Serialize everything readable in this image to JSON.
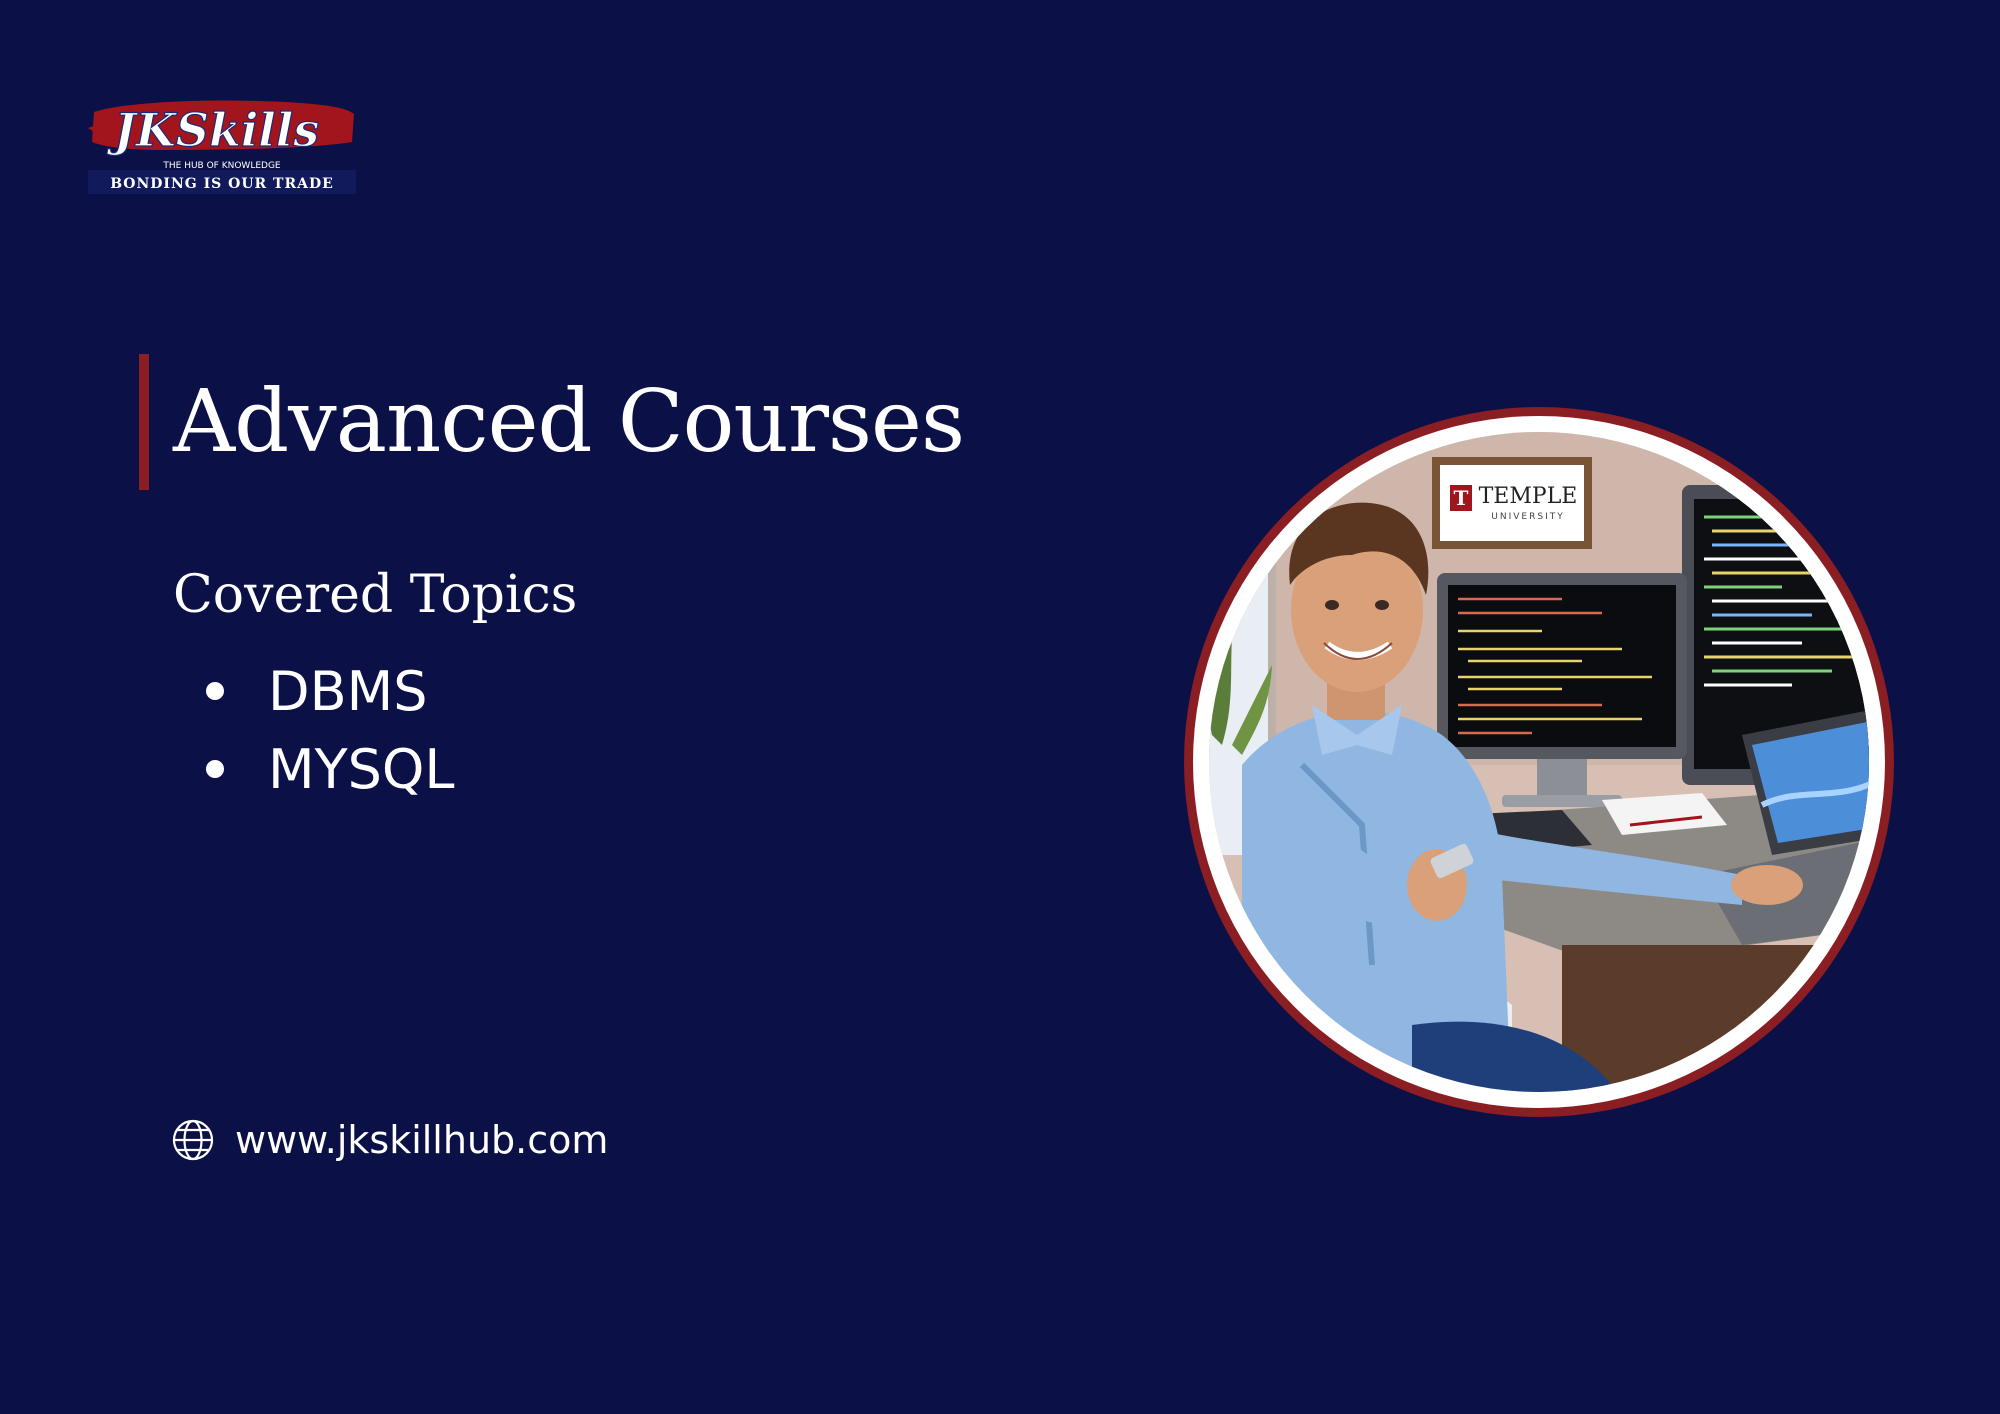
{
  "logo": {
    "wordmark": "JKSkills",
    "tagline_small": "THE HUB OF KNOWLEDGE",
    "tagline": "BONDING IS OUR TRADE"
  },
  "hero": {
    "title": "Advanced Courses"
  },
  "topics": {
    "heading": "Covered Topics",
    "items": [
      "DBMS",
      "MYSQL"
    ]
  },
  "contact": {
    "website": "www.jkskillhub.com",
    "icon": "globe-icon"
  },
  "illustration": {
    "sign_name": "TEMPLE",
    "sign_sub": "UNIVERSITY"
  },
  "colors": {
    "background": "#0b1147",
    "accent": "#8b1e22",
    "text": "#ffffff"
  }
}
